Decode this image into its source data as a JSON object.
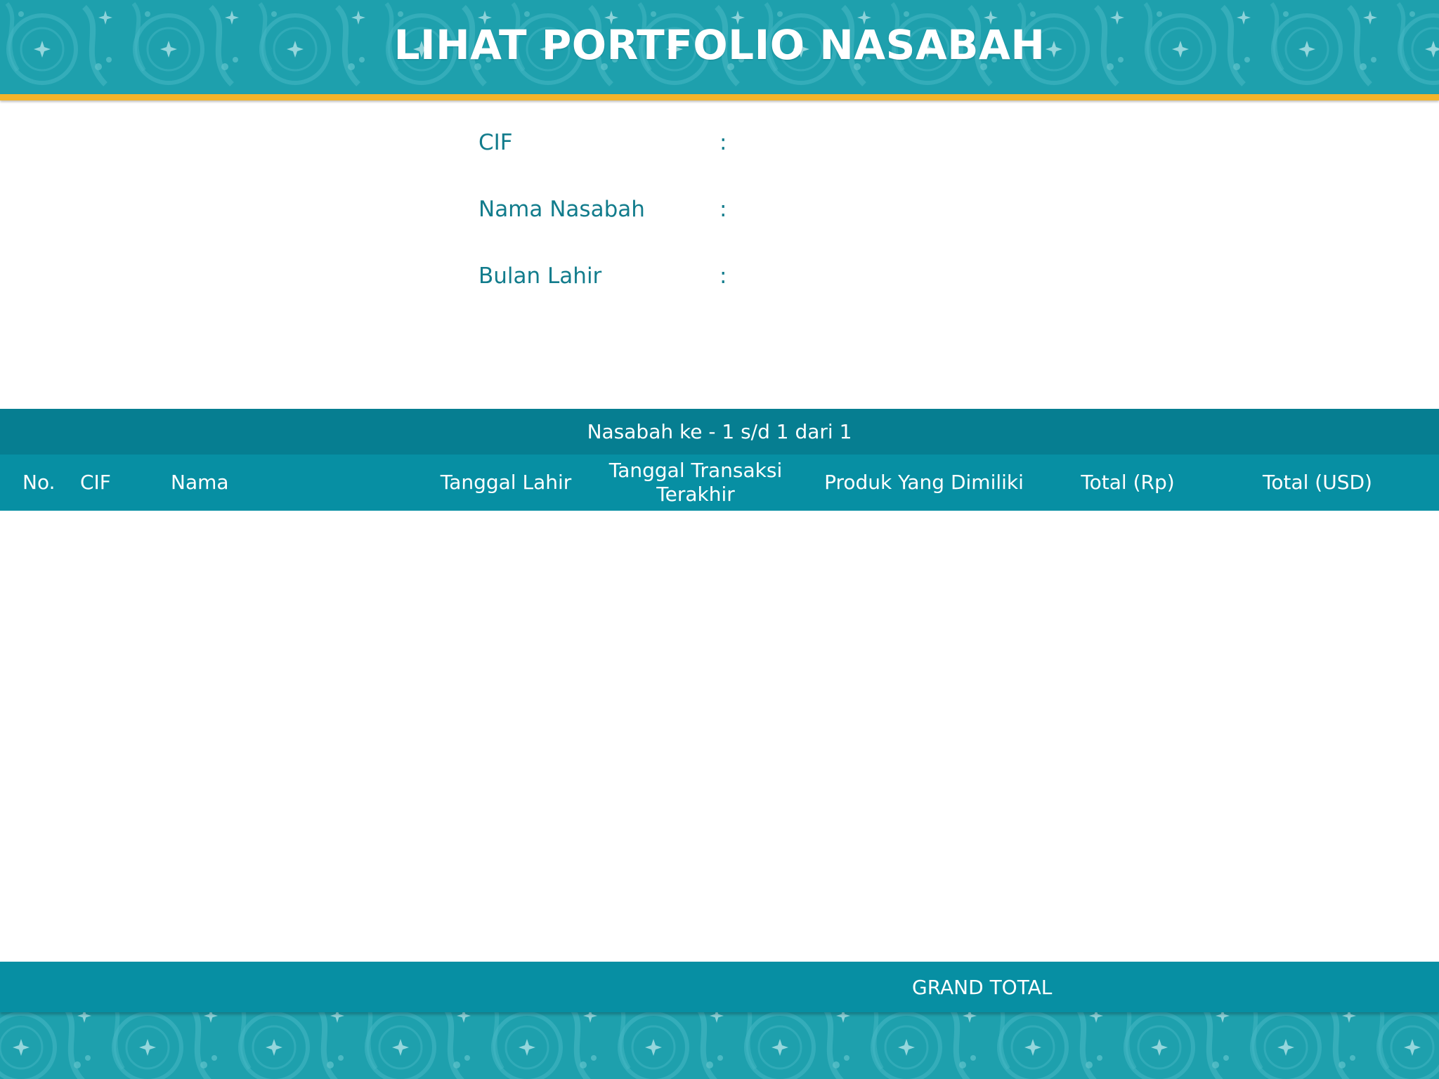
{
  "header": {
    "title": "LIHAT PORTFOLIO NASABAH"
  },
  "info": {
    "colon": ":",
    "fields": [
      {
        "label": "CIF",
        "value": ""
      },
      {
        "label": "Nama Nasabah",
        "value": ""
      },
      {
        "label": "Bulan Lahir",
        "value": ""
      }
    ]
  },
  "table": {
    "pager_text": "Nasabah ke - 1 s/d 1 dari 1",
    "columns": {
      "no": "No.",
      "cif": "CIF",
      "nama": "Nama",
      "tanggal_lahir": "Tanggal Lahir",
      "tanggal_transaksi_line1": "Tanggal Transaksi",
      "tanggal_transaksi_line2": "Terakhir",
      "produk": "Produk Yang Dimiliki",
      "total_rp": "Total (Rp)",
      "total_usd": "Total (USD)"
    },
    "rows": [],
    "grand_total_label": "GRAND TOTAL"
  },
  "colors": {
    "header_teal": "#1ea0ad",
    "accent_strip": "#f2b42a",
    "pager_bar": "#067e91",
    "table_header": "#078fa3",
    "label_text": "#127c8c"
  }
}
